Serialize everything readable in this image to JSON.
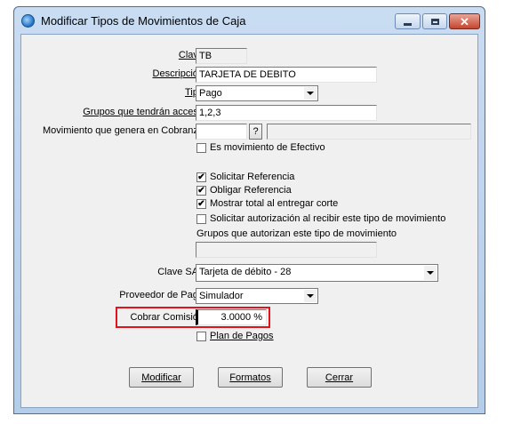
{
  "window": {
    "title": "Modificar Tipos de Movimientos de Caja",
    "close_glyph": "✕"
  },
  "form": {
    "clave": {
      "label": "Clave",
      "value": "TB"
    },
    "descripcion": {
      "label": "Descripción",
      "value": "TARJETA DE DEBITO"
    },
    "tipo": {
      "label": "Tipo",
      "value": "Pago"
    },
    "grupos_acceso": {
      "label": "Grupos que tendrán acceso",
      "value": "1,2,3"
    },
    "movimiento_cobranza": {
      "label": "Movimiento que genera en Cobranza",
      "value": "",
      "lookup_label": "?",
      "description_value": ""
    },
    "es_efectivo": {
      "label": "Es movimiento de Efectivo",
      "checked": false
    },
    "solicitar_referencia": {
      "label": "Solicitar Referencia",
      "checked": true
    },
    "obligar_referencia": {
      "label": "Obligar Referencia",
      "checked": true
    },
    "mostrar_total": {
      "label": "Mostrar total al entregar corte",
      "checked": true
    },
    "solicitar_autorizacion": {
      "label": "Solicitar autorización al recibir este tipo de movimiento",
      "checked": false
    },
    "grupos_autorizan": {
      "label": "Grupos que autorizan este tipo de movimiento",
      "value": ""
    },
    "clave_sat": {
      "label": "Clave SAT",
      "value": "Tarjeta de débito - 28"
    },
    "proveedor_pago": {
      "label": "Proveedor de Pago",
      "value": "Simulador"
    },
    "cobrar_comision": {
      "label": "Cobrar Comisión",
      "value": "3.0000 %"
    },
    "plan_pagos": {
      "label": "Plan de Pagos",
      "checked": false
    }
  },
  "buttons": {
    "modificar": "Modificar",
    "formatos": "Formatos",
    "cerrar": "Cerrar"
  },
  "colors": {
    "highlight": "#e3131b",
    "title_bar": "#b4cde9"
  },
  "check_mark": "✔"
}
